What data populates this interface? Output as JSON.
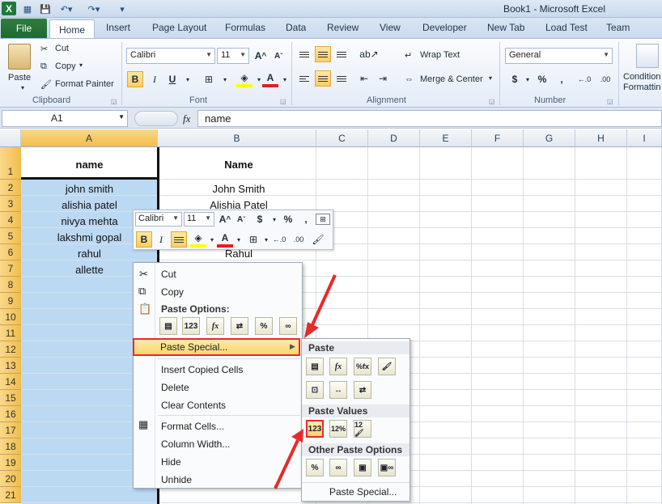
{
  "window": {
    "title": "Book1 - Microsoft Excel",
    "logo": "X"
  },
  "tabs": {
    "file": "File",
    "home": "Home",
    "insert": "Insert",
    "page_layout": "Page Layout",
    "formulas": "Formulas",
    "data": "Data",
    "review": "Review",
    "view": "View",
    "developer": "Developer",
    "new_tab": "New Tab",
    "load_test": "Load Test",
    "team": "Team"
  },
  "ribbon": {
    "clipboard": {
      "label": "Clipboard",
      "paste": "Paste",
      "cut": "Cut",
      "copy": "Copy",
      "format_painter": "Format Painter"
    },
    "font": {
      "label": "Font",
      "font_name": "Calibri",
      "font_size": "11",
      "bold": "B",
      "italic": "I",
      "underline": "U"
    },
    "alignment": {
      "label": "Alignment",
      "wrap_text": "Wrap Text",
      "merge_center": "Merge & Center"
    },
    "number": {
      "label": "Number",
      "format": "General",
      "currency": "$",
      "percent": "%",
      "comma": ","
    },
    "styles": {
      "conditional_line1": "Condition",
      "conditional_line2": "Formattin"
    }
  },
  "formula_bar": {
    "name_box": "A1",
    "fx": "fx",
    "content": "name"
  },
  "columns": [
    "A",
    "B",
    "C",
    "D",
    "E",
    "F",
    "G",
    "H",
    "I"
  ],
  "rows": [
    "1",
    "2",
    "3",
    "4",
    "5",
    "6",
    "7",
    "8",
    "9",
    "10",
    "11",
    "12",
    "13",
    "14",
    "15",
    "16",
    "17",
    "18",
    "19",
    "20",
    "21"
  ],
  "cells": {
    "A": [
      "name",
      "john smith",
      "alishia patel",
      "nivya mehta",
      "lakshmi gopal",
      "rahul",
      "allette"
    ],
    "B": [
      "Name",
      "John Smith",
      "Alishia Patel",
      "",
      "",
      "Rahul"
    ]
  },
  "mini_toolbar": {
    "font": "Calibri",
    "size": "11",
    "bold": "B",
    "italic": "I",
    "currency": "$",
    "percent": "%",
    "comma": ","
  },
  "context_menu": {
    "cut": "Cut",
    "copy": "Copy",
    "paste_options": "Paste Options:",
    "paste_special": "Paste Special...",
    "insert_copied": "Insert Copied Cells",
    "delete": "Delete",
    "clear_contents": "Clear Contents",
    "format_cells": "Format Cells...",
    "column_width": "Column Width...",
    "hide": "Hide",
    "unhide": "Unhide"
  },
  "submenu": {
    "paste": "Paste",
    "paste_values": "Paste Values",
    "other": "Other Paste Options",
    "paste_special": "Paste Special..."
  },
  "highlight_color": "#e62b2b"
}
